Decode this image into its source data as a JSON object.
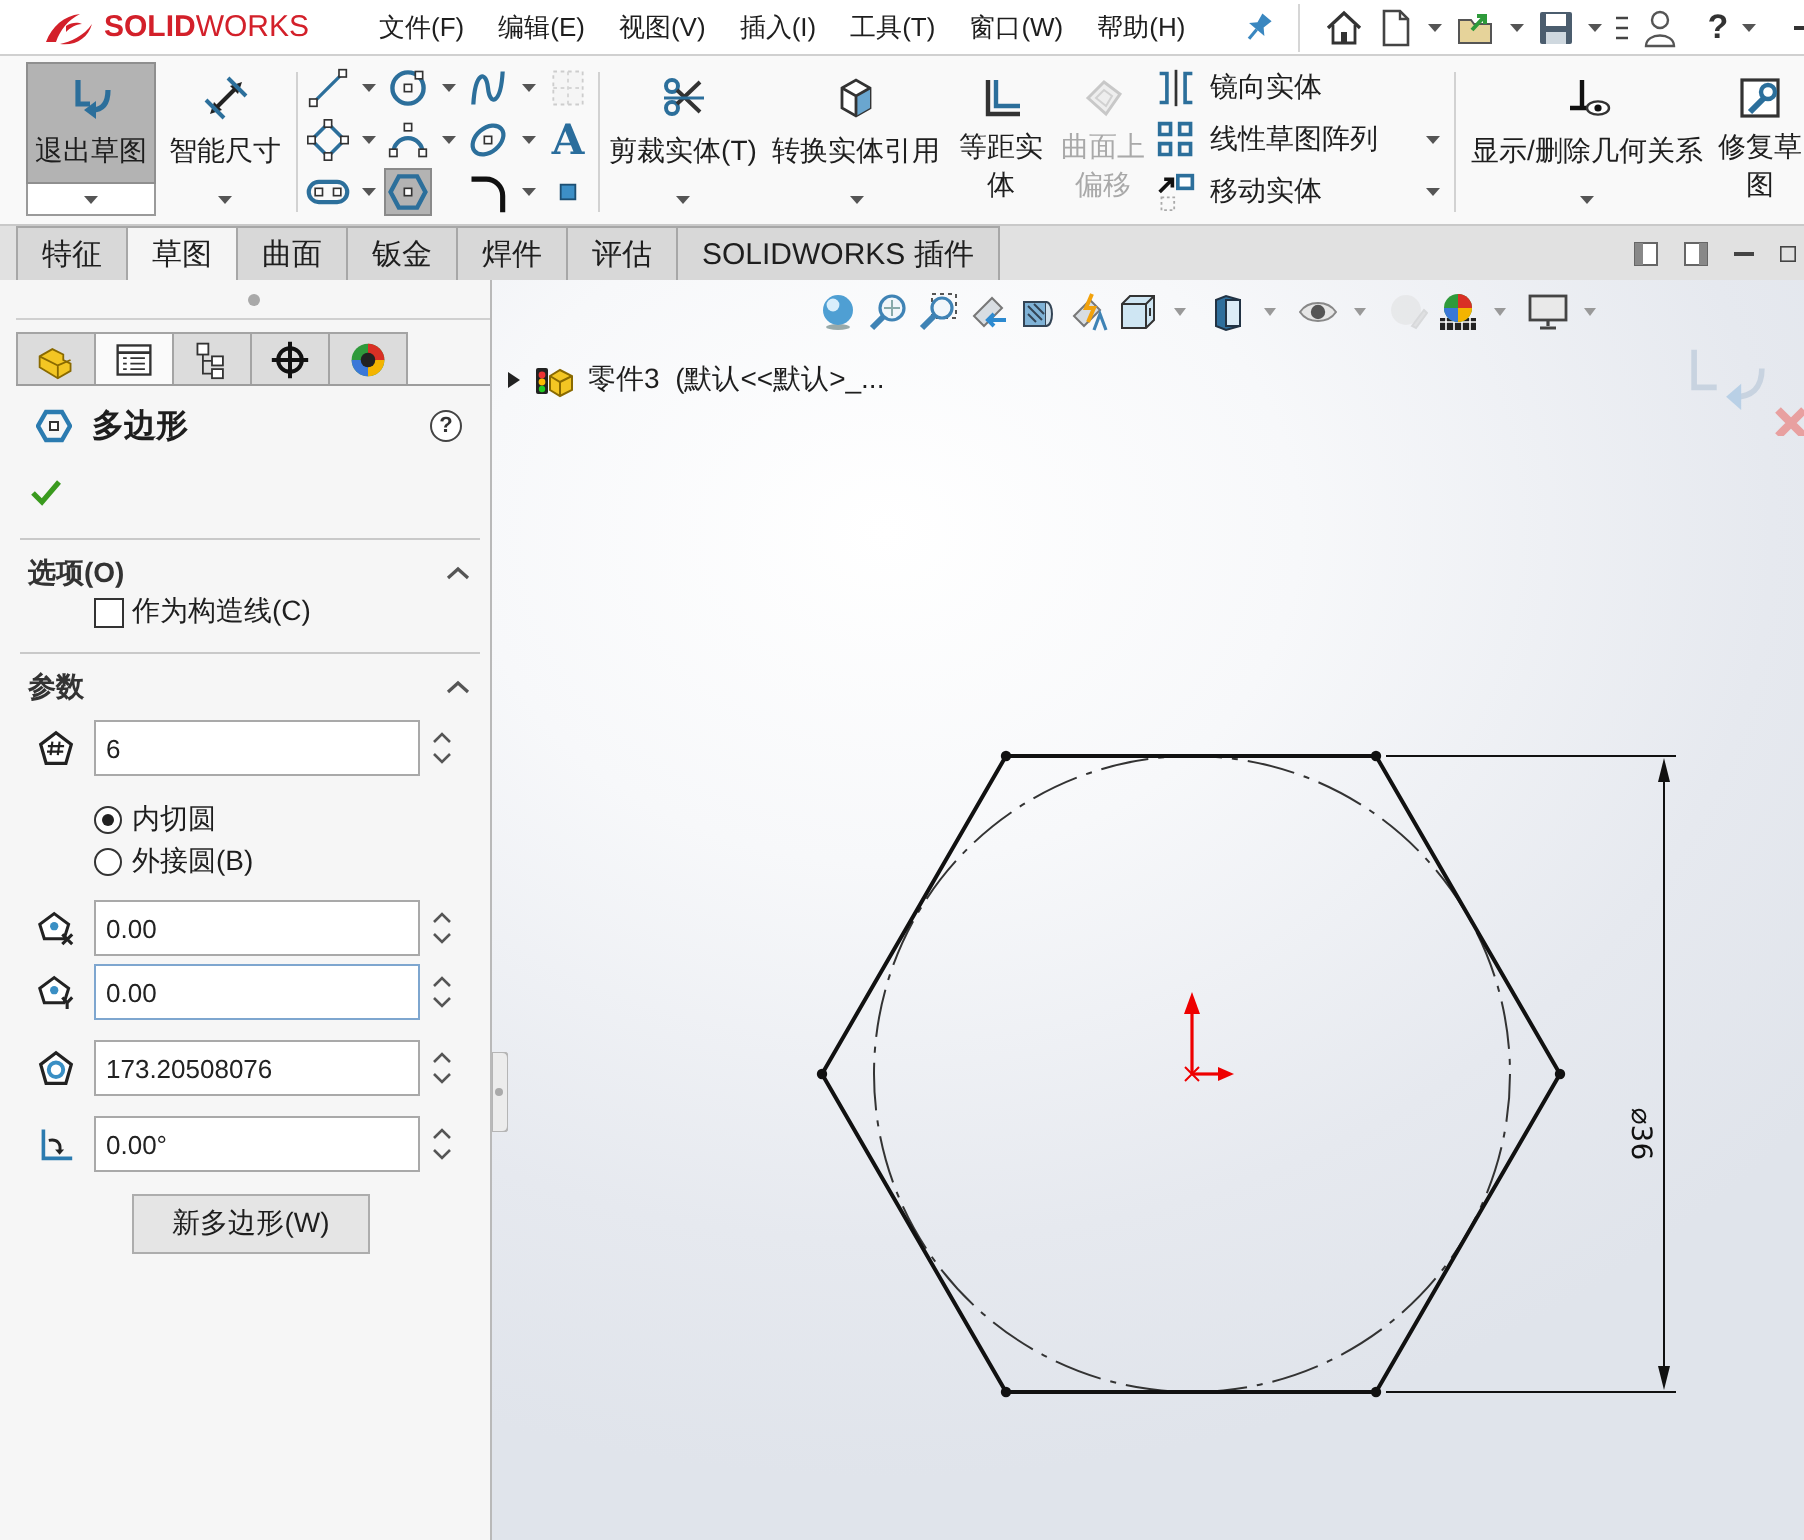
{
  "app": {
    "logo": "**SOLID**WORKS"
  },
  "menu": [
    "文件(F)",
    "编辑(E)",
    "视图(V)",
    "插入(I)",
    "工具(T)",
    "窗口(W)",
    "帮助(H)"
  ],
  "quick_access": {
    "help": "?"
  },
  "ribbon": {
    "sketch_buttons": [
      {
        "label": "退出草图",
        "selected": true,
        "dropdown": true
      },
      {
        "label": "智能尺寸",
        "selected": false,
        "dropdown": true
      }
    ],
    "sketch_tools": [
      {
        "selected": false,
        "disabled": false,
        "dropdown": true
      },
      {
        "selected": false,
        "disabled": false,
        "dropdown": true
      },
      {
        "selected": false,
        "disabled": false,
        "dropdown": true
      },
      {
        "selected": false,
        "disabled": true,
        "dropdown": false
      },
      {
        "selected": false,
        "disabled": false,
        "dropdown": true
      },
      {
        "selected": false,
        "disabled": false,
        "dropdown": true
      },
      {
        "selected": false,
        "disabled": false,
        "dropdown": true
      },
      {
        "glyph": "A",
        "selected": false,
        "disabled": false,
        "dropdown": false
      },
      {
        "selected": false,
        "disabled": false,
        "dropdown": true
      },
      {
        "selected": true,
        "disabled": false,
        "dropdown": false
      },
      {
        "selected": false,
        "disabled": false,
        "dropdown": true
      },
      {
        "selected": false,
        "disabled": false,
        "dropdown": false
      }
    ],
    "edit_buttons": [
      {
        "label": "剪裁实体(T)",
        "disabled": false,
        "dropdown": true
      },
      {
        "label": "转换实体引用",
        "disabled": false,
        "dropdown": true
      },
      {
        "label": "等距实体",
        "disabled": false,
        "dropdown": false
      },
      {
        "label": "曲面上偏移",
        "disabled": true,
        "dropdown": false
      }
    ],
    "list_tools": [
      {
        "label": "镜向实体",
        "dropdown": false
      },
      {
        "label": "线性草图阵列",
        "dropdown": true
      },
      {
        "label": "移动实体",
        "dropdown": true
      }
    ],
    "relation_buttons": [
      {
        "label": "显示/删除几何关系",
        "disabled": false,
        "dropdown": true
      },
      {
        "label": "修复草图",
        "disabled": false,
        "dropdown": false
      }
    ]
  },
  "tabs": [
    {
      "label": "特征",
      "selected": false
    },
    {
      "label": "草图",
      "selected": true
    },
    {
      "label": "曲面",
      "selected": false
    },
    {
      "label": "钣金",
      "selected": false
    },
    {
      "label": "焊件",
      "selected": false
    },
    {
      "label": "评估",
      "selected": false
    },
    {
      "label": "SOLIDWORKS 插件",
      "selected": false
    }
  ],
  "property_manager": {
    "panel_tabs": [
      {
        "selected": false
      },
      {
        "selected": true
      },
      {
        "selected": false
      },
      {
        "selected": false
      },
      {
        "selected": false
      }
    ],
    "title": "多边形",
    "help": "?",
    "options": {
      "title": "选项(O)",
      "expanded": true,
      "construction": {
        "label": "作为构造线(C)",
        "checked": false
      }
    },
    "parameters": {
      "title": "参数",
      "expanded": true,
      "sides": {
        "value": "6",
        "focused": false
      },
      "modes": [
        {
          "label": "内切圆",
          "selected": true
        },
        {
          "label": "外接圆(B)",
          "selected": false
        }
      ],
      "fields": [
        {
          "value": "0.00",
          "focused": false
        },
        {
          "value": "0.00",
          "focused": true
        },
        {
          "value": "173.20508076",
          "focused": false
        },
        {
          "value": "0.00°",
          "focused": false
        }
      ],
      "new_button": "新多边形(W)"
    }
  },
  "graphics": {
    "tree": {
      "label": "零件3  (默认<<默认>_...",
      "expanded": false
    },
    "dimension": "⌀36"
  }
}
